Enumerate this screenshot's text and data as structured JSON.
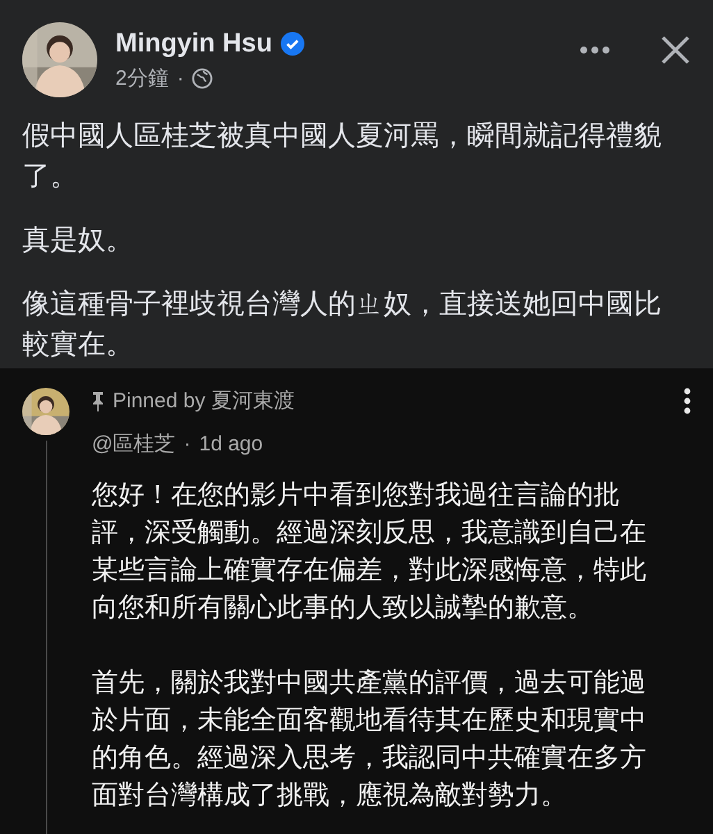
{
  "post": {
    "author": "Mingyin Hsu",
    "verified": true,
    "time": "2分鐘",
    "separator": "·",
    "paragraphs": [
      "假中國人區桂芝被真中國人夏河罵，瞬間就記得禮貌了。",
      "真是奴。",
      "像這種骨子裡歧視台灣人的ㄓ奴，直接送她回中國比較實在。"
    ]
  },
  "comment": {
    "pinned_label": "Pinned by 夏河東渡",
    "handle": "@區桂芝",
    "separator": "·",
    "time": "1d ago",
    "paragraphs": [
      "您好！在您的影片中看到您對我過往言論的批評，深受觸動。經過深刻反思，我意識到自己在某些言論上確實存在偏差，對此深感悔意，特此向您和所有關心此事的人致以誠摯的歉意。",
      "首先，關於我對中國共產黨的評價，過去可能過於片面，未能全面客觀地看待其在歷史和現實中的角色。經過深入思考，我認同中共確實在多方面對台灣構成了挑戰，應視為敵對勢力。"
    ]
  }
}
